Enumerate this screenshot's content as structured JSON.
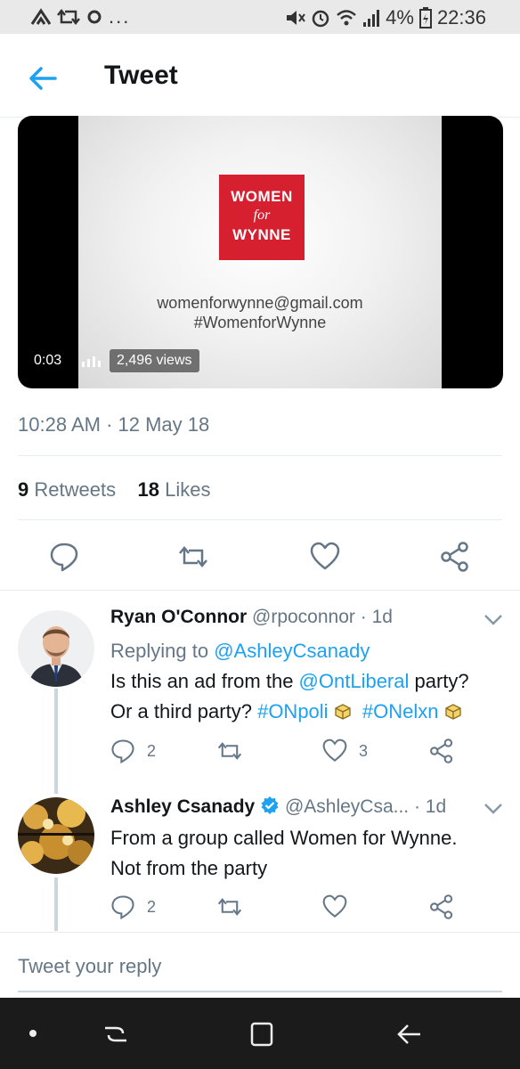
{
  "status_bar": {
    "left_icons": [
      "notification-icon",
      "retweet-notif-icon",
      "dot-icon"
    ],
    "left_more": "...",
    "battery": "4%",
    "time": "22:36"
  },
  "header": {
    "title": "Tweet"
  },
  "video": {
    "logo_line1": "WOMEN",
    "logo_line2": "for",
    "logo_line3": "WYNNE",
    "email": "womenforwynne@gmail.com",
    "hashtag": "#WomenforWynne",
    "elapsed": "0:03",
    "views": "2,496 views",
    "brand_color": "#d6202f"
  },
  "tweet": {
    "timestamp": "10:28 AM · 12 May 18",
    "retweets_count": "9",
    "retweets_label": "Retweets",
    "likes_count": "18",
    "likes_label": "Likes"
  },
  "replies": [
    {
      "name": "Ryan O'Connor",
      "handle": "@rpoconnor",
      "age": "· 1d",
      "replying_prefix": "Replying to",
      "replying_handle": "@AshleyCsanady",
      "text_a": "Is this an ad from the ",
      "mention": "@OntLiberal",
      "text_b": " party?",
      "text_c": "Or a third party? ",
      "tag1": "#ONpoli",
      "tag2": "#ONelxn",
      "reply_count": "2",
      "like_count": "3"
    },
    {
      "name": "Ashley Csanady",
      "handle": "@AshleyCsa...",
      "age": "· 1d",
      "text_line1": "From a group called Women for Wynne.",
      "text_line2": "Not from the party",
      "reply_count": "2"
    }
  ],
  "reply_box": {
    "placeholder": "Tweet your reply"
  },
  "colors": {
    "accent": "#1da1f2",
    "muted": "#657786",
    "verified": "#1da1f2"
  }
}
